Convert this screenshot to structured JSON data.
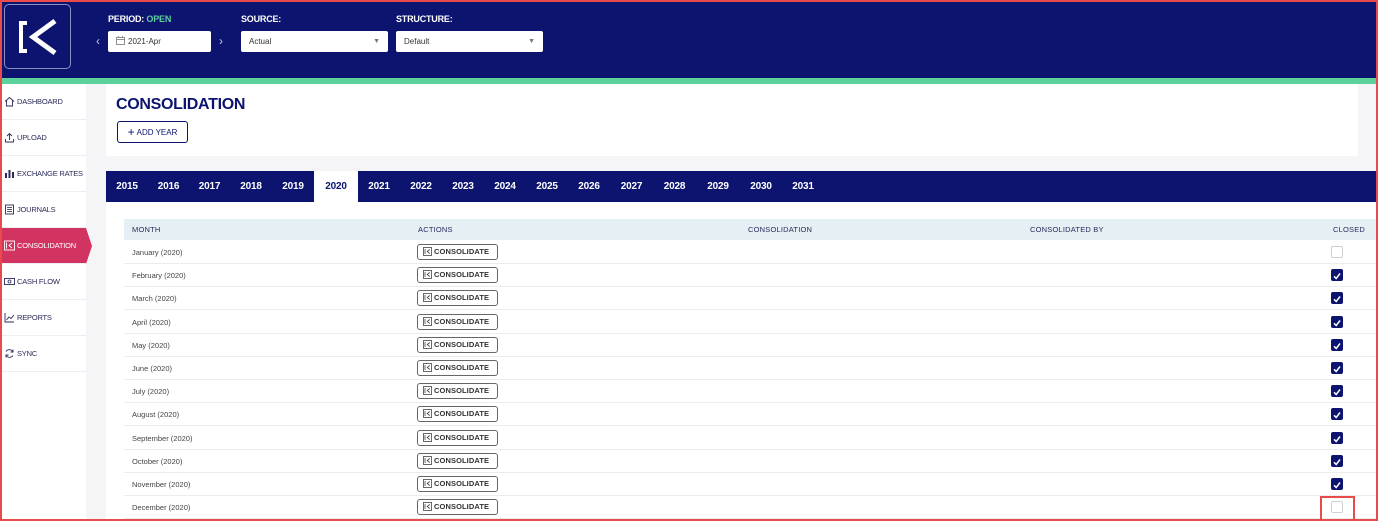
{
  "header": {
    "period_label": "PERIOD:",
    "period_status": "OPEN",
    "period_value": "2021-Apr",
    "source_label": "SOURCE:",
    "source_value": "Actual",
    "structure_label": "STRUCTURE:",
    "structure_value": "Default"
  },
  "sidebar": {
    "items": [
      {
        "label": "DASHBOARD",
        "icon": "home-icon"
      },
      {
        "label": "UPLOAD",
        "icon": "upload-icon"
      },
      {
        "label": "EXCHANGE RATES",
        "icon": "bar-chart-icon"
      },
      {
        "label": "JOURNALS",
        "icon": "journal-icon"
      },
      {
        "label": "CONSOLIDATION",
        "icon": "consolidate-icon"
      },
      {
        "label": "CASH FLOW",
        "icon": "cash-icon"
      },
      {
        "label": "REPORTS",
        "icon": "line-chart-icon"
      },
      {
        "label": "SYNC",
        "icon": "sync-icon"
      }
    ],
    "active_index": 4
  },
  "page": {
    "title": "CONSOLIDATION",
    "add_year_label": "ADD YEAR"
  },
  "years": [
    "2015",
    "2016",
    "2017",
    "2018",
    "2019",
    "2020",
    "2021",
    "2022",
    "2023",
    "2024",
    "2025",
    "2026",
    "2027",
    "2028",
    "2029",
    "2030",
    "2031"
  ],
  "active_year": "2020",
  "table": {
    "headers": {
      "month": "MONTH",
      "actions": "ACTIONS",
      "consolidation": "CONSOLIDATION",
      "consolidated_by": "CONSOLIDATED BY",
      "closed": "CLOSED"
    },
    "button_label": "CONSOLIDATE",
    "rows": [
      {
        "month": "January (2020)",
        "closed": false
      },
      {
        "month": "February (2020)",
        "closed": true
      },
      {
        "month": "March (2020)",
        "closed": true
      },
      {
        "month": "April (2020)",
        "closed": true
      },
      {
        "month": "May (2020)",
        "closed": true
      },
      {
        "month": "June (2020)",
        "closed": true
      },
      {
        "month": "July (2020)",
        "closed": true
      },
      {
        "month": "August (2020)",
        "closed": true
      },
      {
        "month": "September (2020)",
        "closed": true
      },
      {
        "month": "October (2020)",
        "closed": true
      },
      {
        "month": "November (2020)",
        "closed": true
      },
      {
        "month": "December (2020)",
        "closed": false
      }
    ]
  },
  "colors": {
    "navy": "#0c1470",
    "accent_green": "#5bd19c",
    "active_pink": "#d23462"
  }
}
